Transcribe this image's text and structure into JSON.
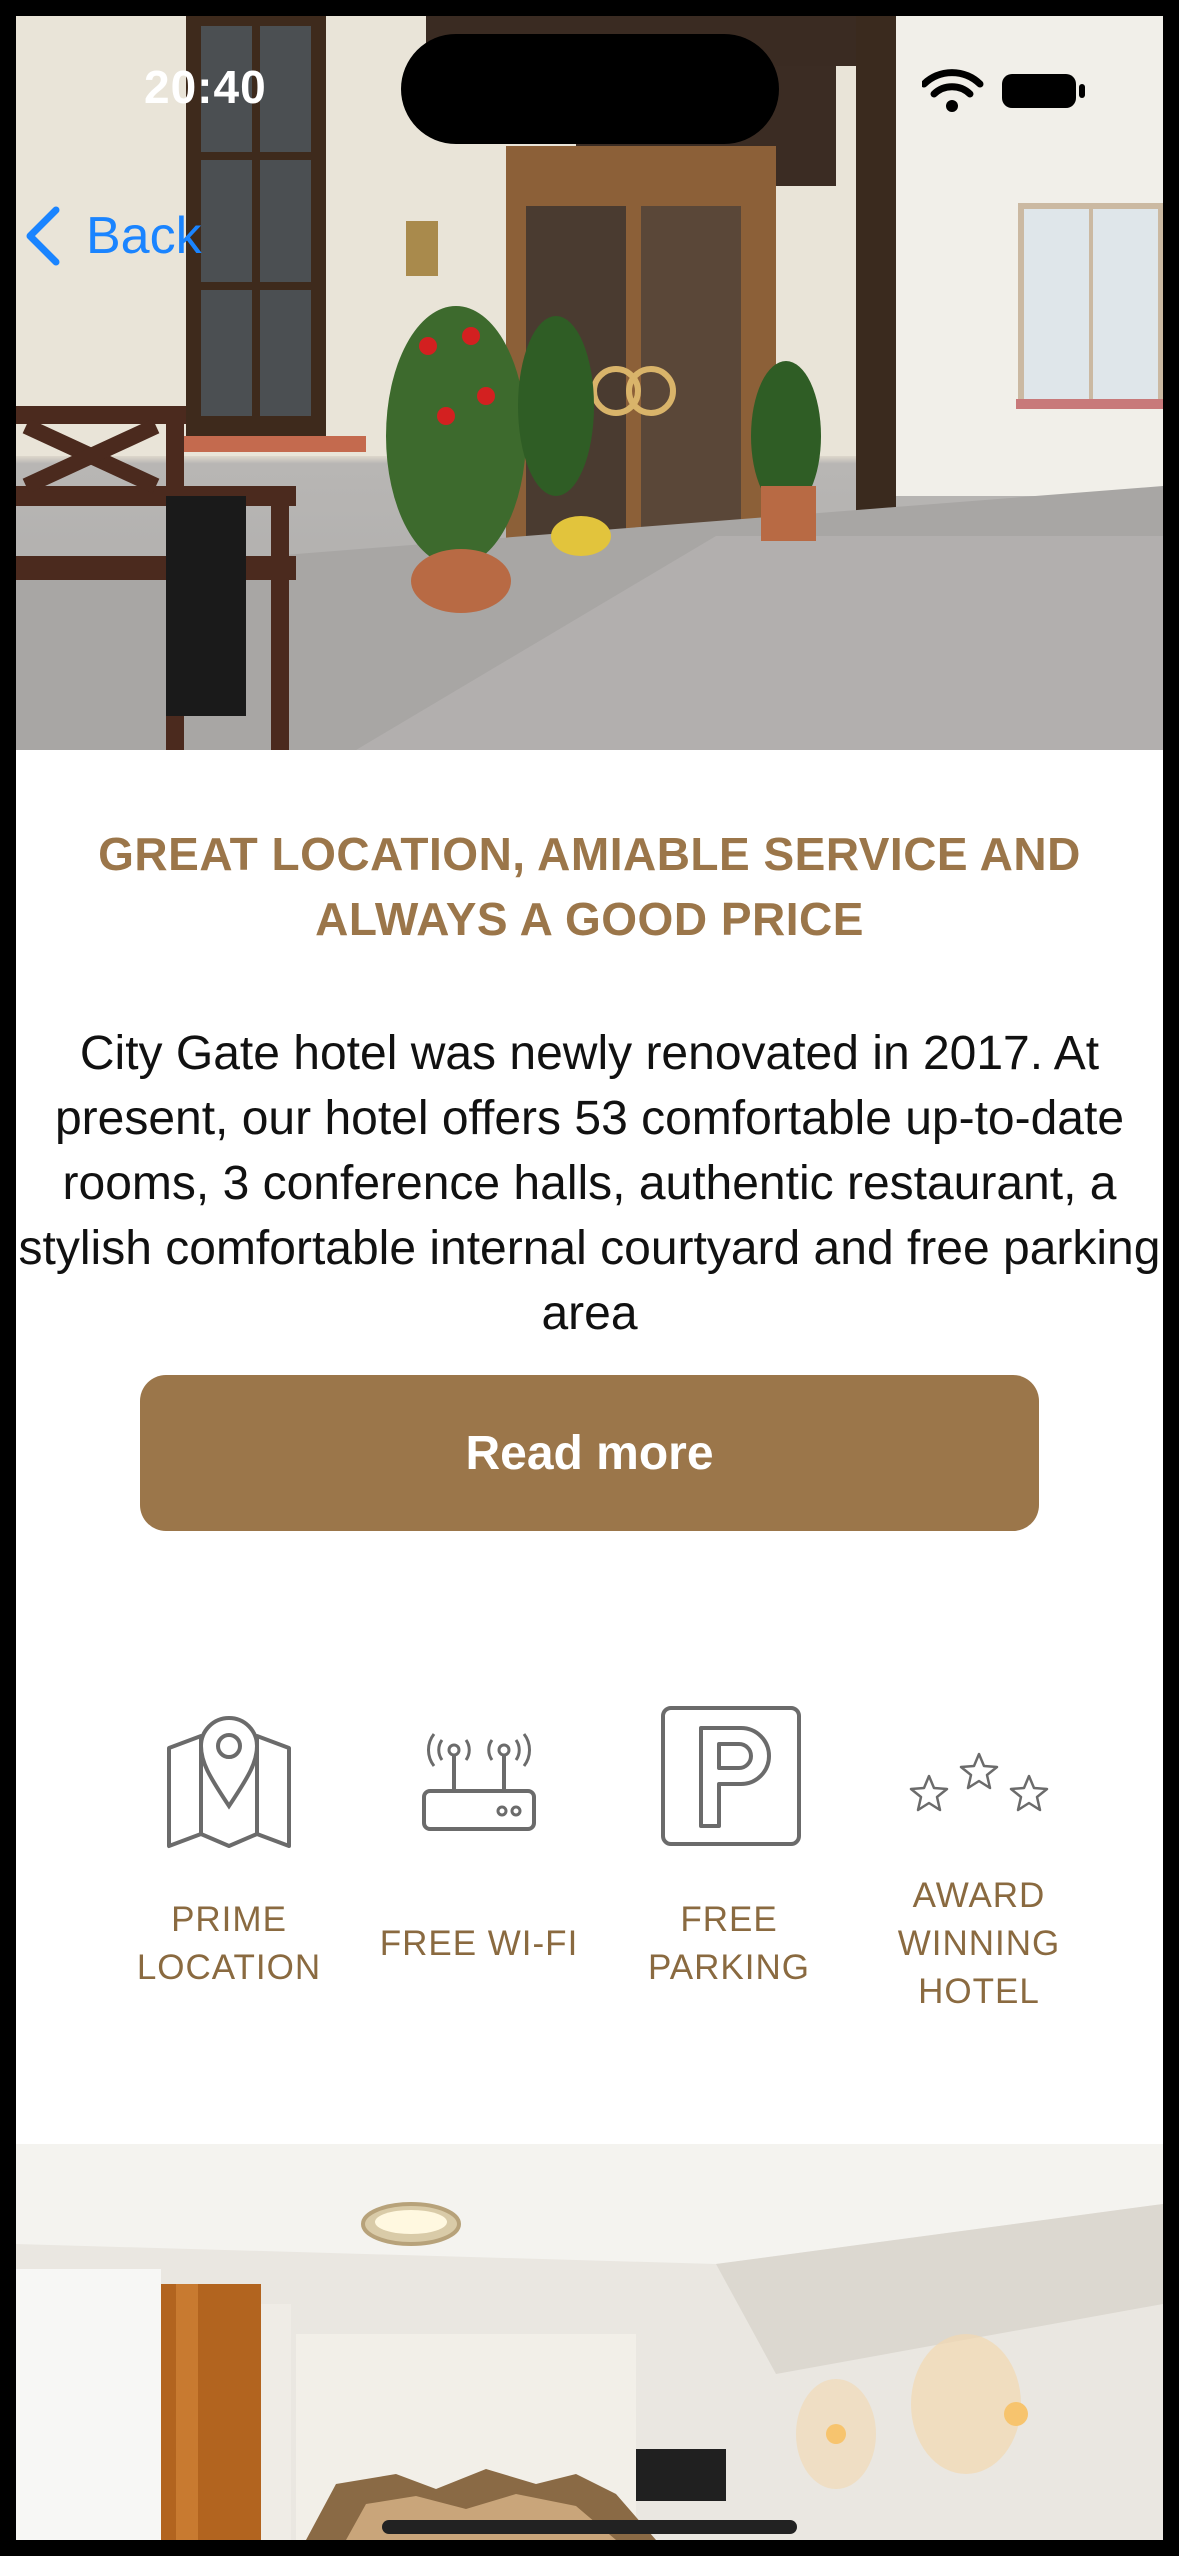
{
  "status_bar": {
    "time": "20:40",
    "icons": [
      "wifi-icon",
      "battery-icon"
    ]
  },
  "nav": {
    "back_label": "Back"
  },
  "hero": {
    "image": "hotel-entrance-photo"
  },
  "content": {
    "headline": "GREAT LOCATION, AMIABLE SERVICE AND ALWAYS A GOOD PRICE",
    "description": "City Gate hotel was newly renovated in 2017. At present, our hotel offers 53 comfortable up-to-date rooms, 3 conference halls, authentic restaurant, a stylish comfortable internal courtyard and free parking area",
    "read_more_label": "Read more"
  },
  "features": [
    {
      "icon": "map-pin-icon",
      "label": "PRIME LOCATION"
    },
    {
      "icon": "wifi-router-icon",
      "label": "FREE WI-FI"
    },
    {
      "icon": "parking-icon",
      "label": "FREE PARKING"
    },
    {
      "icon": "stars-icon",
      "label": "AWARD WINNING HOTEL"
    }
  ],
  "room_photo": {
    "image": "hotel-room-photo"
  },
  "colors": {
    "accent": "#9b764a",
    "link": "#1a84ff",
    "icon_stroke": "#6b6b6b"
  }
}
